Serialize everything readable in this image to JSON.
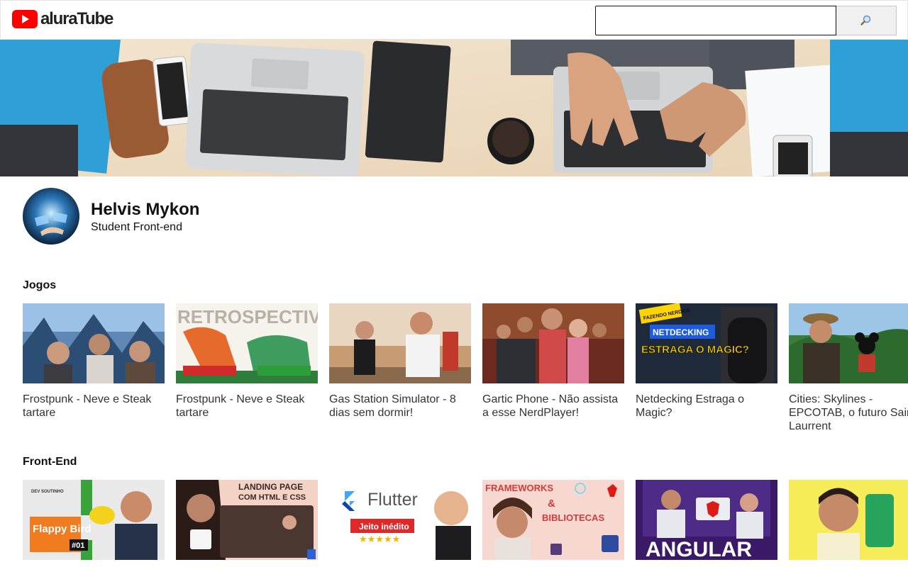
{
  "header": {
    "logo_text": "aluraTube",
    "search": {
      "value": "",
      "placeholder": ""
    },
    "search_button_icon": "magnifier-icon"
  },
  "banner": {
    "description_icon": "banner-image"
  },
  "profile": {
    "name": "Helvis Mykon",
    "role": "Student Front-end"
  },
  "playlists": [
    {
      "title": "Jogos",
      "videos": [
        {
          "title": "Frostpunk - Neve e Steak tartare",
          "thumb_text": ""
        },
        {
          "title": "Frostpunk - Neve e Steak tartare",
          "thumb_text": "RETROSPECTIVA"
        },
        {
          "title": "Gas Station Simulator - 8 dias sem dormir!",
          "thumb_text": ""
        },
        {
          "title": "Gartic Phone - Não assista a esse NerdPlayer!",
          "thumb_text": ""
        },
        {
          "title": "Netdecking Estraga o Magic?",
          "thumb_text": "ESTRAGA O MAGIC?",
          "thumb_tag": "NETDECKING",
          "thumb_corner": "FAZENDO NERDICE"
        },
        {
          "title": "Cities: Skylines - EPCOTAB, o futuro Saint Laurrent",
          "thumb_text": ""
        }
      ]
    },
    {
      "title": "Front-End",
      "videos": [
        {
          "title": "",
          "thumb_text": "Flappy Bird",
          "thumb_tag": "#01",
          "thumb_corner": "DEV SOUTINHO"
        },
        {
          "title": "",
          "thumb_text": "LANDING PAGE",
          "thumb_tag": "COM HTML E CSS"
        },
        {
          "title": "",
          "thumb_text": "Flutter",
          "thumb_tag": "Jeito inédito",
          "thumb_corner": "★★★★★"
        },
        {
          "title": "",
          "thumb_text": "FRAMEWORKS",
          "thumb_tag": "&",
          "thumb_corner": "BIBLIOTECAS"
        },
        {
          "title": "",
          "thumb_text": "ANGULAR"
        },
        {
          "title": "",
          "thumb_text": ""
        }
      ]
    }
  ],
  "colors": {
    "logo_red": "#ff0000",
    "header_border": "#e5e5e5",
    "search_button_bg": "#f0f0f0"
  }
}
